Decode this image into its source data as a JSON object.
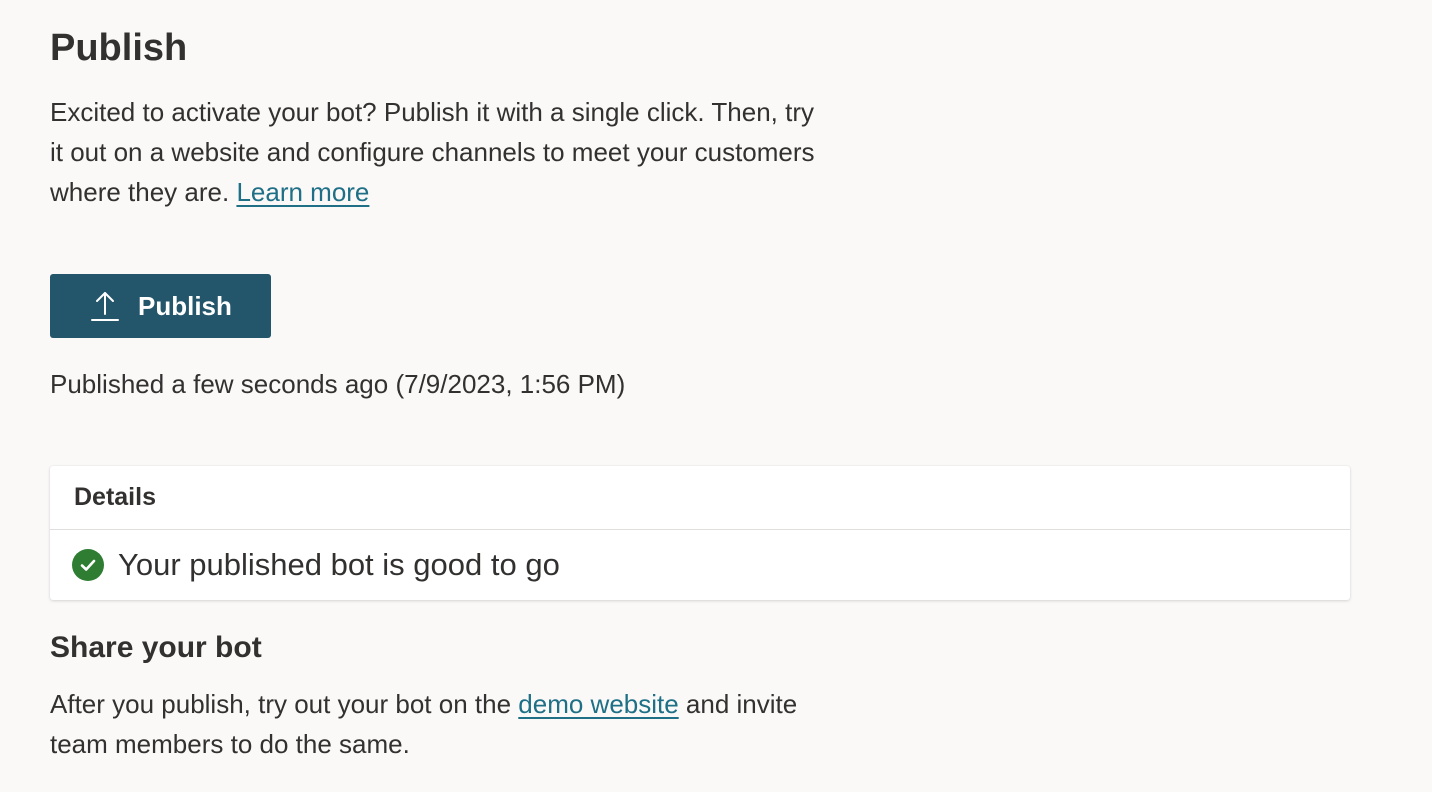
{
  "header": {
    "title": "Publish"
  },
  "intro": {
    "text": "Excited to activate your bot? Publish it with a single click. Then, try it out on a website and configure channels to meet your customers where they are. ",
    "learn_more_link": "Learn more"
  },
  "publish_button": {
    "label": "Publish",
    "icon": "upload-icon",
    "color": "#23566b"
  },
  "status": {
    "published_text": "Published a few seconds ago (7/9/2023, 1:56 PM)"
  },
  "details": {
    "header": "Details",
    "status_icon": "check-circle-icon",
    "status_icon_color": "#2f7d32",
    "status_message": "Your published bot is good to go"
  },
  "share": {
    "title": "Share your bot",
    "text_before": "After you publish, try out your bot on the ",
    "demo_link": "demo website",
    "text_after": " and invite team members to do the same."
  },
  "colors": {
    "background": "#faf9f8",
    "link": "#1f6f86",
    "text": "#323130"
  }
}
